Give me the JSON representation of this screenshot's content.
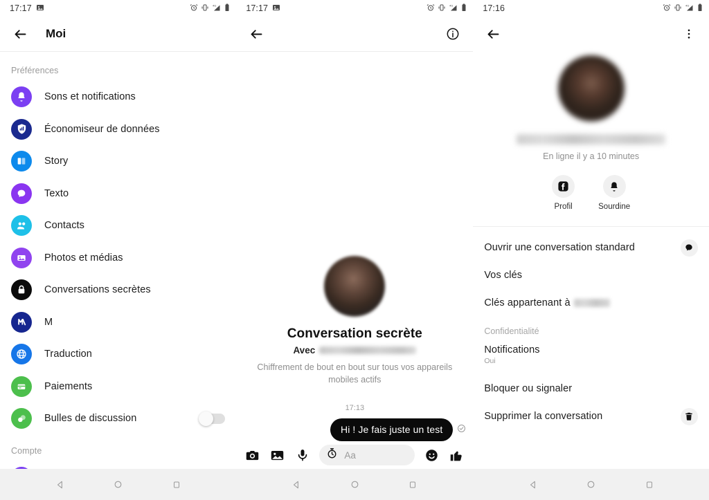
{
  "panels": {
    "settings": {
      "status": {
        "time": "17:17",
        "icons": [
          "image-icon",
          "alarm-icon",
          "vibrate-icon",
          "signal-4g-icon",
          "battery-icon"
        ]
      },
      "appbar": {
        "title": "Moi",
        "back_icon": "back-arrow-icon"
      },
      "sections": [
        {
          "label": "Préférences",
          "items": [
            {
              "label": "Sons et notifications",
              "icon": "bell-icon",
              "color": "#7b3ff2"
            },
            {
              "label": "Économiseur de données",
              "icon": "shield-signal-icon",
              "color": "#1b2a8f"
            },
            {
              "label": "Story",
              "icon": "story-book-icon",
              "color": "#0d8aec"
            },
            {
              "label": "Texto",
              "icon": "chat-bubble-icon",
              "color": "#8a35f0"
            },
            {
              "label": "Contacts",
              "icon": "people-icon",
              "color": "#1ec0e8"
            },
            {
              "label": "Photos et médias",
              "icon": "photo-icon",
              "color": "#9043ef"
            },
            {
              "label": "Conversations secrètes",
              "icon": "lock-icon",
              "color": "#0b0b0b"
            },
            {
              "label": "M",
              "icon": "m-assistant-icon",
              "color": "#16268f"
            },
            {
              "label": "Traduction",
              "icon": "globe-icon",
              "color": "#1676e8"
            },
            {
              "label": "Paiements",
              "icon": "payment-card-icon",
              "color": "#4cbf4c"
            },
            {
              "label": "Bulles de discussion",
              "icon": "bubbles-icon",
              "color": "#4cbf4c",
              "toggle": "off"
            }
          ]
        },
        {
          "label": "Compte",
          "items": []
        }
      ]
    },
    "conversation": {
      "status": {
        "time": "17:17",
        "icons": [
          "image-icon",
          "alarm-icon",
          "vibrate-icon",
          "signal-4g-icon",
          "battery-icon"
        ]
      },
      "appbar": {
        "back_icon": "back-arrow-icon",
        "info_icon": "info-circle-icon"
      },
      "intro": {
        "title": "Conversation secrète",
        "with_label": "Avec",
        "with_name_redacted": true,
        "description": "Chiffrement de bout en bout sur tous vos appareils mobiles actifs"
      },
      "messages": [
        {
          "timestamp": "17:13",
          "text": "Hi ! Je fais juste un test",
          "outgoing": true,
          "receipt": "delivered-check-icon"
        }
      ],
      "composer": {
        "placeholder": "Aa",
        "icons": [
          "camera-icon",
          "gallery-icon",
          "microphone-icon",
          "timer-icon",
          "emoji-icon",
          "thumbs-up-icon"
        ]
      }
    },
    "details": {
      "status": {
        "time": "17:16",
        "icons": [
          "alarm-icon",
          "vibrate-icon",
          "signal-4g-icon",
          "battery-icon"
        ]
      },
      "appbar": {
        "back_icon": "back-arrow-icon",
        "overflow_icon": "more-vertical-icon"
      },
      "hero": {
        "name_redacted": true,
        "status_text": "En ligne il y a 10 minutes",
        "actions": [
          {
            "label": "Profil",
            "icon": "facebook-icon"
          },
          {
            "label": "Sourdine",
            "icon": "bell-icon"
          }
        ]
      },
      "rows": [
        {
          "label": "Ouvrir une conversation standard",
          "trailing_icon": "chat-bubble-icon"
        },
        {
          "label": "Vos clés"
        },
        {
          "label": "Clés appartenant à",
          "redacted_suffix": true
        }
      ],
      "privacy_section": "Confidentialité",
      "privacy_rows": [
        {
          "label": "Notifications",
          "value": "Oui"
        },
        {
          "label": "Bloquer ou signaler"
        },
        {
          "label": "Supprimer la conversation",
          "trailing_icon": "trash-icon"
        }
      ]
    }
  },
  "navbar": {
    "icons": [
      "back-triangle-icon",
      "home-circle-icon",
      "recents-square-icon"
    ]
  }
}
